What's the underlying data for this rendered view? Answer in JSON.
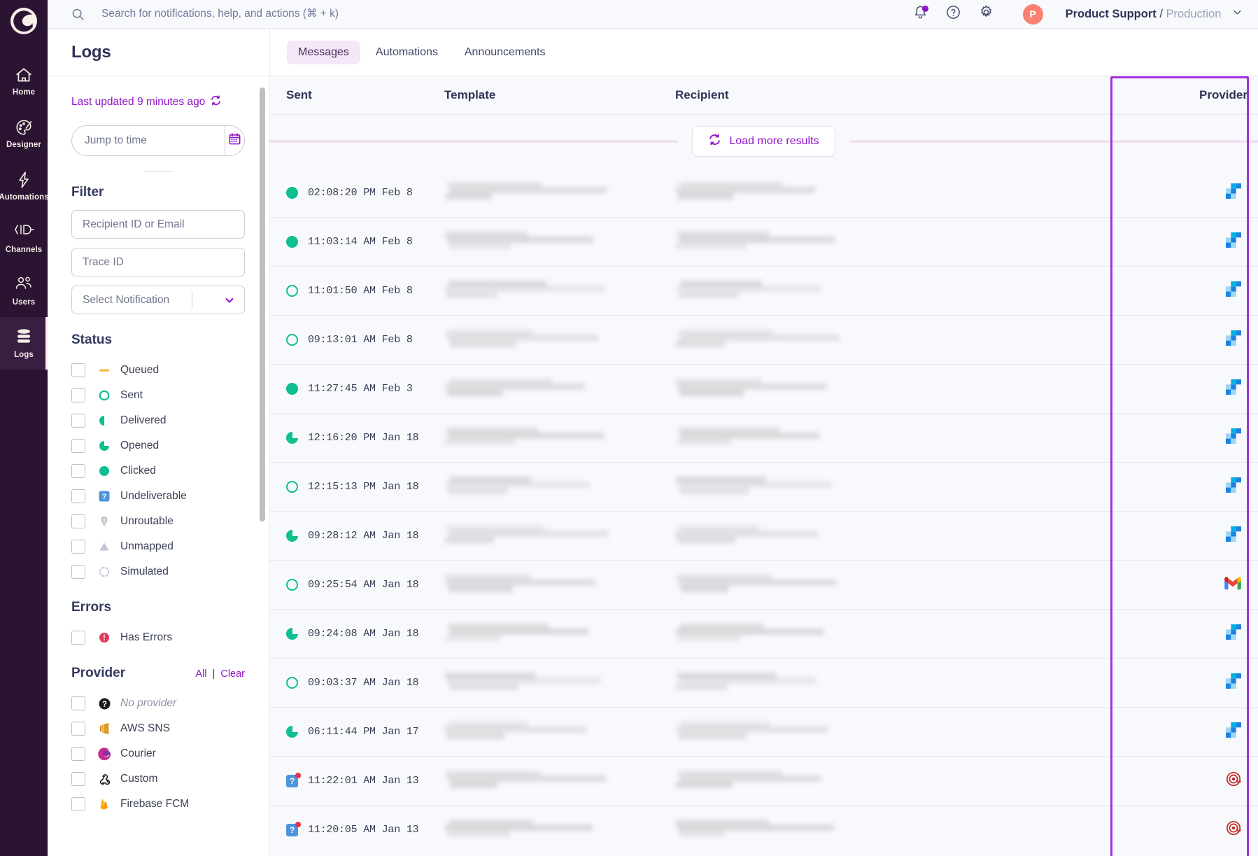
{
  "brand": {
    "accent": "#9013C4",
    "rail_bg": "#2B1432",
    "green": "#0FBF8F",
    "highlight": "#A630DC"
  },
  "rail": {
    "logo_name": "courier-logo",
    "items": [
      {
        "label": "Home",
        "icon": "home-icon",
        "active": false
      },
      {
        "label": "Designer",
        "icon": "palette-icon",
        "active": false
      },
      {
        "label": "Automations",
        "icon": "lightning-icon",
        "active": false
      },
      {
        "label": "Channels",
        "icon": "channels-icon",
        "active": false
      },
      {
        "label": "Users",
        "icon": "users-icon",
        "active": false
      },
      {
        "label": "Logs",
        "icon": "database-icon",
        "active": true
      }
    ]
  },
  "topbar": {
    "search_placeholder": "Search for notifications, help, and actions (⌘ + k)",
    "search_value": "",
    "notifications_icon": "bell-icon",
    "help_icon": "question-circle-icon",
    "settings_icon": "gear-icon",
    "avatar_initial": "P",
    "workspace": "Product Support",
    "separator": "/",
    "environment": "Production"
  },
  "page": {
    "title": "Logs",
    "tabs": [
      {
        "label": "Messages",
        "active": true
      },
      {
        "label": "Automations",
        "active": false
      },
      {
        "label": "Announcements",
        "active": false
      }
    ]
  },
  "filters": {
    "last_updated": "Last updated 9 minutes ago",
    "refresh_icon": "refresh-icon",
    "jump_placeholder": "Jump to time",
    "jump_value": "",
    "calendar_icon": "calendar-icon",
    "filter_title": "Filter",
    "recipient_placeholder": "Recipient ID or Email",
    "recipient_value": "",
    "trace_placeholder": "Trace ID",
    "trace_value": "",
    "notification_select": "Select Notification",
    "status_title": "Status",
    "status_items": [
      {
        "label": "Queued",
        "icon": "queued-dash-icon",
        "checked": false
      },
      {
        "label": "Sent",
        "icon": "sent-ring-icon",
        "checked": false
      },
      {
        "label": "Delivered",
        "icon": "delivered-half-icon",
        "checked": false
      },
      {
        "label": "Opened",
        "icon": "opened-quarter-icon",
        "checked": false
      },
      {
        "label": "Clicked",
        "icon": "clicked-filled-icon",
        "checked": false
      },
      {
        "label": "Undeliverable",
        "icon": "undeliverable-question-icon",
        "checked": false
      },
      {
        "label": "Unroutable",
        "icon": "unroutable-pin-icon",
        "checked": false
      },
      {
        "label": "Unmapped",
        "icon": "unmapped-triangle-icon",
        "checked": false
      },
      {
        "label": "Simulated",
        "icon": "simulated-dotted-icon",
        "checked": false
      }
    ],
    "errors_title": "Errors",
    "error_items": [
      {
        "label": "Has Errors",
        "icon": "error-alert-icon",
        "checked": false
      }
    ],
    "provider_title": "Provider",
    "provider_all": "All",
    "provider_divider": "|",
    "provider_clear": "Clear",
    "provider_items": [
      {
        "label": "No provider",
        "icon": "no-provider-icon",
        "checked": false,
        "muted": true
      },
      {
        "label": "AWS SNS",
        "icon": "aws-sns-icon",
        "checked": false,
        "muted": false
      },
      {
        "label": "Courier",
        "icon": "courier-icon",
        "checked": false,
        "muted": false
      },
      {
        "label": "Custom",
        "icon": "custom-webhook-icon",
        "checked": false,
        "muted": false
      },
      {
        "label": "Firebase FCM",
        "icon": "firebase-fcm-icon",
        "checked": false,
        "muted": false
      }
    ]
  },
  "table": {
    "columns": [
      {
        "key": "sent",
        "label": "Sent"
      },
      {
        "key": "template",
        "label": "Template"
      },
      {
        "key": "recipient",
        "label": "Recipient"
      },
      {
        "key": "provider",
        "label": "Provider"
      }
    ],
    "load_more_label": "Load more results",
    "load_more_icon": "refresh-icon",
    "rows": [
      {
        "status": "clicked",
        "timestamp": "02:08:20 PM Feb 8",
        "template": "redacted",
        "recipient": "redacted",
        "provider": "sendgrid-icon",
        "has_error": false
      },
      {
        "status": "clicked",
        "timestamp": "11:03:14 AM Feb 8",
        "template": "redacted",
        "recipient": "redacted",
        "provider": "sendgrid-icon",
        "has_error": false
      },
      {
        "status": "sent",
        "timestamp": "11:01:50 AM Feb 8",
        "template": "redacted",
        "recipient": "redacted",
        "provider": "sendgrid-icon",
        "has_error": false
      },
      {
        "status": "sent",
        "timestamp": "09:13:01 AM Feb 8",
        "template": "redacted",
        "recipient": "redacted",
        "provider": "sendgrid-icon",
        "has_error": false
      },
      {
        "status": "clicked",
        "timestamp": "11:27:45 AM Feb 3",
        "template": "redacted",
        "recipient": "redacted",
        "provider": "sendgrid-icon",
        "has_error": false
      },
      {
        "status": "opened",
        "timestamp": "12:16:20 PM Jan 18",
        "template": "redacted",
        "recipient": "redacted",
        "provider": "sendgrid-icon",
        "has_error": false
      },
      {
        "status": "sent",
        "timestamp": "12:15:13 PM Jan 18",
        "template": "redacted",
        "recipient": "redacted",
        "provider": "sendgrid-icon",
        "has_error": false
      },
      {
        "status": "opened",
        "timestamp": "09:28:12 AM Jan 18",
        "template": "redacted",
        "recipient": "redacted",
        "provider": "sendgrid-icon",
        "has_error": false
      },
      {
        "status": "sent",
        "timestamp": "09:25:54 AM Jan 18",
        "template": "redacted",
        "recipient": "redacted",
        "provider": "gmail-icon",
        "has_error": false
      },
      {
        "status": "opened",
        "timestamp": "09:24:08 AM Jan 18",
        "template": "redacted",
        "recipient": "redacted",
        "provider": "sendgrid-icon",
        "has_error": false
      },
      {
        "status": "sent",
        "timestamp": "09:03:37 AM Jan 18",
        "template": "redacted",
        "recipient": "redacted",
        "provider": "sendgrid-icon",
        "has_error": false
      },
      {
        "status": "opened",
        "timestamp": "06:11:44 PM Jan 17",
        "template": "redacted",
        "recipient": "redacted",
        "provider": "sendgrid-icon",
        "has_error": false
      },
      {
        "status": "undeliverable",
        "timestamp": "11:22:01 AM Jan 13",
        "template": "redacted",
        "recipient": "redacted",
        "provider": "mailgun-icon",
        "has_error": true
      },
      {
        "status": "undeliverable",
        "timestamp": "11:20:05 AM Jan 13",
        "template": "redacted",
        "recipient": "redacted",
        "provider": "mailgun-icon",
        "has_error": true
      }
    ]
  }
}
